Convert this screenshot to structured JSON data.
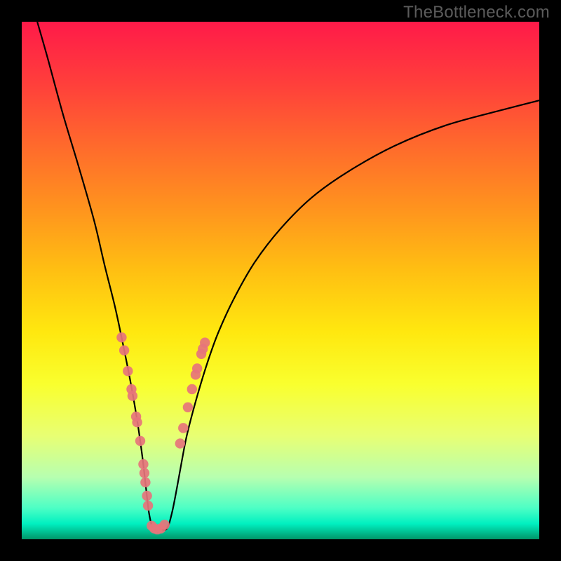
{
  "attribution": "TheBottleneck.com",
  "colors": {
    "curve": "#000000",
    "marker_fill": "#e6747b",
    "marker_stroke": "#b84e57",
    "frame": "#000000"
  },
  "chart_data": {
    "type": "line",
    "title": "",
    "xlabel": "",
    "ylabel": "",
    "xlim": [
      0,
      100
    ],
    "ylim": [
      0,
      100
    ],
    "grid": false,
    "legend": false,
    "series": [
      {
        "name": "bottleneck-curve",
        "x": [
          3,
          5,
          8,
          11,
          14,
          16,
          18,
          19.5,
          21,
          22.3,
          23.3,
          24,
          24.6,
          25.4,
          26.5,
          28,
          29,
          30,
          31,
          32,
          34,
          36,
          38,
          41,
          45,
          50,
          56,
          63,
          72,
          82,
          93,
          100
        ],
        "y": [
          100,
          93,
          82,
          72,
          61.5,
          53,
          45,
          38,
          30.5,
          23,
          16,
          10,
          5,
          2,
          2,
          2,
          5,
          10,
          15.5,
          20.5,
          28,
          34.5,
          40,
          46.5,
          53.5,
          60,
          66,
          71,
          76,
          80,
          83,
          84.8
        ]
      }
    ],
    "markers_left": [
      {
        "x": 19.3,
        "y": 39.0
      },
      {
        "x": 19.8,
        "y": 36.5
      },
      {
        "x": 20.5,
        "y": 32.5
      },
      {
        "x": 21.2,
        "y": 29.0
      },
      {
        "x": 21.4,
        "y": 27.7
      },
      {
        "x": 22.1,
        "y": 23.7
      },
      {
        "x": 22.3,
        "y": 22.6
      },
      {
        "x": 22.9,
        "y": 19.0
      },
      {
        "x": 23.5,
        "y": 14.5
      },
      {
        "x": 23.7,
        "y": 12.8
      },
      {
        "x": 23.9,
        "y": 11.0
      },
      {
        "x": 24.2,
        "y": 8.4
      },
      {
        "x": 24.4,
        "y": 6.5
      }
    ],
    "markers_bottom": [
      {
        "x": 25.1,
        "y": 2.6
      },
      {
        "x": 25.6,
        "y": 2.1
      },
      {
        "x": 26.2,
        "y": 1.9
      },
      {
        "x": 26.9,
        "y": 2.1
      },
      {
        "x": 27.6,
        "y": 2.8
      }
    ],
    "markers_right": [
      {
        "x": 30.6,
        "y": 18.5
      },
      {
        "x": 31.2,
        "y": 21.5
      },
      {
        "x": 32.1,
        "y": 25.5
      },
      {
        "x": 32.9,
        "y": 29.0
      },
      {
        "x": 33.6,
        "y": 31.8
      },
      {
        "x": 33.9,
        "y": 33.0
      },
      {
        "x": 34.7,
        "y": 35.8
      },
      {
        "x": 35.0,
        "y": 36.8
      },
      {
        "x": 35.4,
        "y": 38.0
      }
    ]
  }
}
